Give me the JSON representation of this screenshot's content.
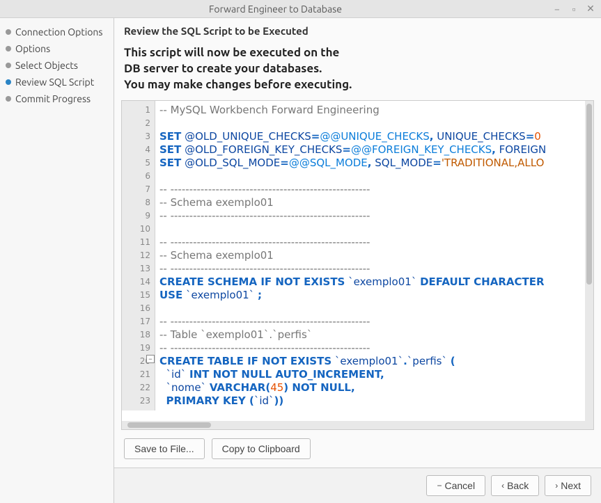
{
  "titlebar": {
    "title": "Forward Engineer to Database"
  },
  "sidebar": {
    "items": [
      {
        "label": "Connection Options"
      },
      {
        "label": "Options"
      },
      {
        "label": "Select Objects"
      },
      {
        "label": "Review SQL Script"
      },
      {
        "label": "Commit Progress"
      }
    ]
  },
  "header": {
    "title": "Review the SQL Script to be Executed"
  },
  "description": {
    "line1": "This script will now be executed on the",
    "line2": "DB server to create your databases.",
    "line3": "You may make changes before executing."
  },
  "editor": {
    "line_numbers": [
      "1",
      "2",
      "3",
      "4",
      "5",
      "6",
      "7",
      "8",
      "9",
      "10",
      "11",
      "12",
      "13",
      "14",
      "15",
      "16",
      "17",
      "18",
      "19",
      "20",
      "21",
      "22",
      "23"
    ],
    "lines": [
      [
        {
          "t": "-- MySQL Workbench Forward Engineering",
          "c": "com"
        }
      ],
      [],
      [
        {
          "t": "SET",
          "c": "kw"
        },
        {
          "t": " @OLD_UNIQUE_CHECKS",
          "c": "var"
        },
        {
          "t": "=",
          "c": "pn"
        },
        {
          "t": "@@UNIQUE_CHECKS",
          "c": "at"
        },
        {
          "t": ",",
          "c": "pn"
        },
        {
          "t": " UNIQUE_CHECKS",
          "c": "var"
        },
        {
          "t": "=",
          "c": "pn"
        },
        {
          "t": "0",
          "c": "num"
        }
      ],
      [
        {
          "t": "SET",
          "c": "kw"
        },
        {
          "t": " @OLD_FOREIGN_KEY_CHECKS",
          "c": "var"
        },
        {
          "t": "=",
          "c": "pn"
        },
        {
          "t": "@@FOREIGN_KEY_CHECKS",
          "c": "at"
        },
        {
          "t": ",",
          "c": "pn"
        },
        {
          "t": " FOREIGN",
          "c": "var"
        }
      ],
      [
        {
          "t": "SET",
          "c": "kw"
        },
        {
          "t": " @OLD_SQL_MODE",
          "c": "var"
        },
        {
          "t": "=",
          "c": "pn"
        },
        {
          "t": "@@SQL_MODE",
          "c": "at"
        },
        {
          "t": ",",
          "c": "pn"
        },
        {
          "t": " SQL_MODE",
          "c": "var"
        },
        {
          "t": "=",
          "c": "pn"
        },
        {
          "t": "'TRADITIONAL,ALLO",
          "c": "str"
        }
      ],
      [],
      [
        {
          "t": "-- -----------------------------------------------------",
          "c": "com"
        }
      ],
      [
        {
          "t": "-- Schema exemplo01",
          "c": "com"
        }
      ],
      [
        {
          "t": "-- -----------------------------------------------------",
          "c": "com"
        }
      ],
      [],
      [
        {
          "t": "-- -----------------------------------------------------",
          "c": "com"
        }
      ],
      [
        {
          "t": "-- Schema exemplo01",
          "c": "com"
        }
      ],
      [
        {
          "t": "-- -----------------------------------------------------",
          "c": "com"
        }
      ],
      [
        {
          "t": "CREATE SCHEMA IF NOT EXISTS",
          "c": "kw"
        },
        {
          "t": " `exemplo01` ",
          "c": "id"
        },
        {
          "t": "DEFAULT CHARACTER",
          "c": "kw"
        }
      ],
      [
        {
          "t": "USE",
          "c": "kw"
        },
        {
          "t": " `exemplo01` ",
          "c": "id"
        },
        {
          "t": ";",
          "c": "pn"
        }
      ],
      [],
      [
        {
          "t": "-- -----------------------------------------------------",
          "c": "com"
        }
      ],
      [
        {
          "t": "-- Table `exemplo01`.`perfis`",
          "c": "com"
        }
      ],
      [
        {
          "t": "-- -----------------------------------------------------",
          "c": "com"
        }
      ],
      [
        {
          "t": "CREATE TABLE IF NOT EXISTS",
          "c": "kw"
        },
        {
          "t": " `exemplo01`",
          "c": "id"
        },
        {
          "t": ".",
          "c": "pn"
        },
        {
          "t": "`perfis` ",
          "c": "id"
        },
        {
          "t": "(",
          "c": "pn"
        }
      ],
      [
        {
          "t": "  `id` ",
          "c": "id"
        },
        {
          "t": "INT NOT NULL AUTO_INCREMENT",
          "c": "kw"
        },
        {
          "t": ",",
          "c": "pn"
        }
      ],
      [
        {
          "t": "  `nome` ",
          "c": "id"
        },
        {
          "t": "VARCHAR",
          "c": "kw"
        },
        {
          "t": "(",
          "c": "pn"
        },
        {
          "t": "45",
          "c": "num"
        },
        {
          "t": ")",
          "c": "pn"
        },
        {
          "t": " NOT NULL",
          "c": "kw"
        },
        {
          "t": ",",
          "c": "pn"
        }
      ],
      [
        {
          "t": "  ",
          "c": ""
        },
        {
          "t": "PRIMARY KEY ",
          "c": "kw"
        },
        {
          "t": "(",
          "c": "pn"
        },
        {
          "t": "`id`",
          "c": "id"
        },
        {
          "t": "))",
          "c": "pn"
        }
      ]
    ]
  },
  "buttons": {
    "save_to_file": "Save to File...",
    "copy_clipboard": "Copy to Clipboard"
  },
  "footer": {
    "cancel": "Cancel",
    "back": "Back",
    "next": "Next"
  }
}
